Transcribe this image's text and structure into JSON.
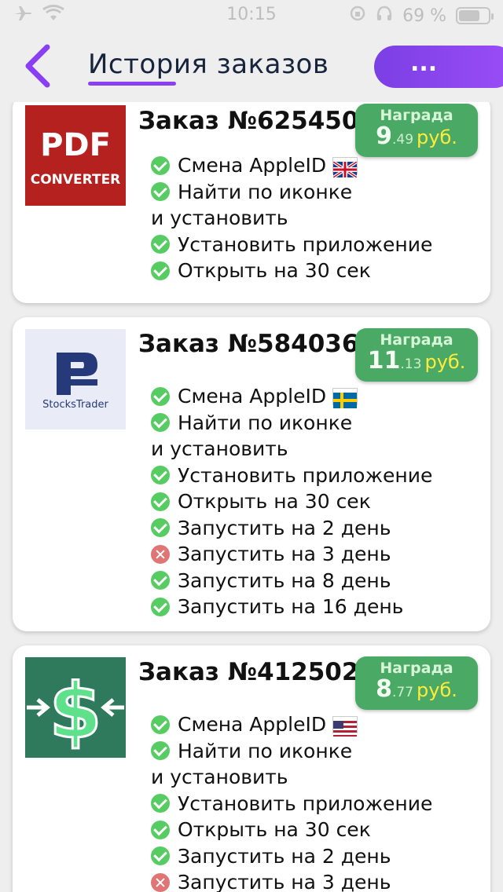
{
  "status_bar": {
    "time": "10:15",
    "battery": "69 %"
  },
  "header": {
    "title": "История заказов",
    "more_label": "..."
  },
  "orders": [
    {
      "title": "Заказ №625450",
      "icon": "pdf-converter-app-icon",
      "icon_text_1": "PDF",
      "icon_text_2": "CONVERTER",
      "reward_label": "Награда",
      "reward_int": "9",
      "reward_frac": ".49",
      "reward_currency": "руб.",
      "tasks": [
        {
          "text": "Смена AppleID",
          "status": "done",
          "flag": "uk-flag"
        },
        {
          "text": "Найти по иконке",
          "status": "done"
        },
        {
          "text": "и установить",
          "status": "continuation"
        },
        {
          "text": "Установить приложение",
          "status": "done"
        },
        {
          "text": "Открыть на 30 сек",
          "status": "done"
        }
      ]
    },
    {
      "title": "Заказ №584036",
      "icon": "stockstrader-app-icon",
      "icon_text_1": "StocksTrader",
      "reward_label": "Награда",
      "reward_int": "11",
      "reward_frac": ".13",
      "reward_currency": "руб.",
      "tasks": [
        {
          "text": "Смена AppleID",
          "status": "done",
          "flag": "sweden-flag"
        },
        {
          "text": "Найти по иконке",
          "status": "done"
        },
        {
          "text": "и установить",
          "status": "continuation"
        },
        {
          "text": "Установить приложение",
          "status": "done"
        },
        {
          "text": "Открыть на 30 сек",
          "status": "done"
        },
        {
          "text": "Запустить на 2 день",
          "status": "done"
        },
        {
          "text": "Запустить на 3 день",
          "status": "failed"
        },
        {
          "text": "Запустить на 8 день",
          "status": "done"
        },
        {
          "text": "Запустить на 16 день",
          "status": "done"
        }
      ]
    },
    {
      "title": "Заказ №412502",
      "icon": "dollar-converter-app-icon",
      "reward_label": "Награда",
      "reward_int": "8",
      "reward_frac": ".77",
      "reward_currency": "руб.",
      "tasks": [
        {
          "text": "Смена AppleID",
          "status": "done",
          "flag": "usa-flag"
        },
        {
          "text": "Найти по иконке",
          "status": "done"
        },
        {
          "text": "и установить",
          "status": "continuation"
        },
        {
          "text": "Установить приложение",
          "status": "done"
        },
        {
          "text": "Открыть на 30 сек",
          "status": "done"
        },
        {
          "text": "Запустить на 2 день",
          "status": "done"
        },
        {
          "text": "Запустить на 3 день",
          "status": "failed"
        }
      ]
    }
  ]
}
